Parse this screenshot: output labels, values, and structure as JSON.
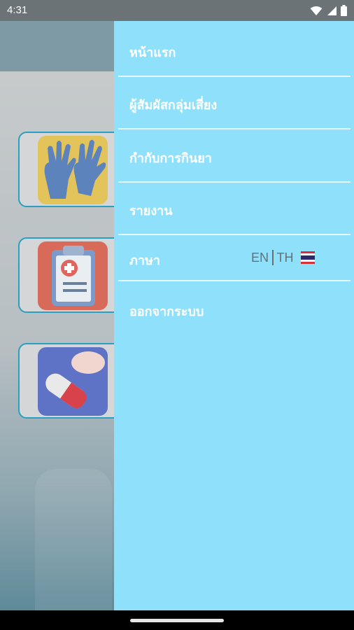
{
  "status_bar": {
    "time": "4:31",
    "icons": [
      "wifi-icon",
      "signal-icon",
      "battery-icon"
    ]
  },
  "background_app": {
    "cards": [
      {
        "icon": "gloves-icon"
      },
      {
        "icon": "medical-clipboard-icon"
      },
      {
        "icon": "pill-capsule-icon"
      }
    ]
  },
  "drawer": {
    "items": [
      {
        "label": "หน้าแรก"
      },
      {
        "label": "ผู้สัมผัสกลุ่มเสี่ยง"
      },
      {
        "label": "กำกับการกินยา"
      },
      {
        "label": "รายงาน"
      },
      {
        "label": "ภาษา"
      },
      {
        "label": "ออกจากระบบ"
      }
    ],
    "language": {
      "en": "EN",
      "th": "TH",
      "flag_icon": "thai-flag-icon"
    }
  },
  "colors": {
    "drawer_bg": "#8fe0fb",
    "card_border": "#2a9fc0",
    "menu_text": "#ffffff"
  }
}
